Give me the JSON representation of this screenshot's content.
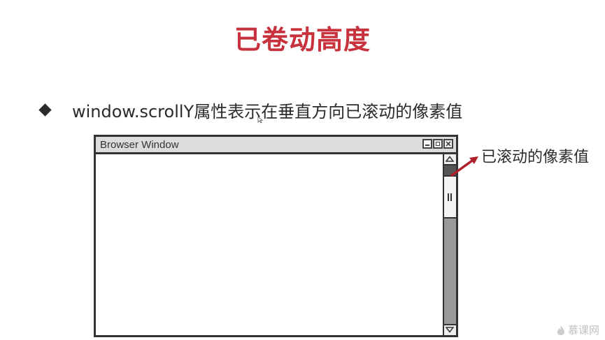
{
  "slide": {
    "title": "已卷动高度",
    "bullet": "window.scrollY属性表示在垂直方向已滚动的像素值"
  },
  "browser_window": {
    "title": "Browser Window",
    "controls": [
      "minimize-icon",
      "maximize-icon",
      "close-icon"
    ],
    "scroll_fraction": 0.04
  },
  "annotation": {
    "label": "已滚动的像素值",
    "arrow_color": "#b0202a"
  },
  "watermark": {
    "text": "慕课网",
    "icon": "flame-logo-icon"
  },
  "colors": {
    "title": "#c8323d",
    "text": "#2b2b2b"
  }
}
